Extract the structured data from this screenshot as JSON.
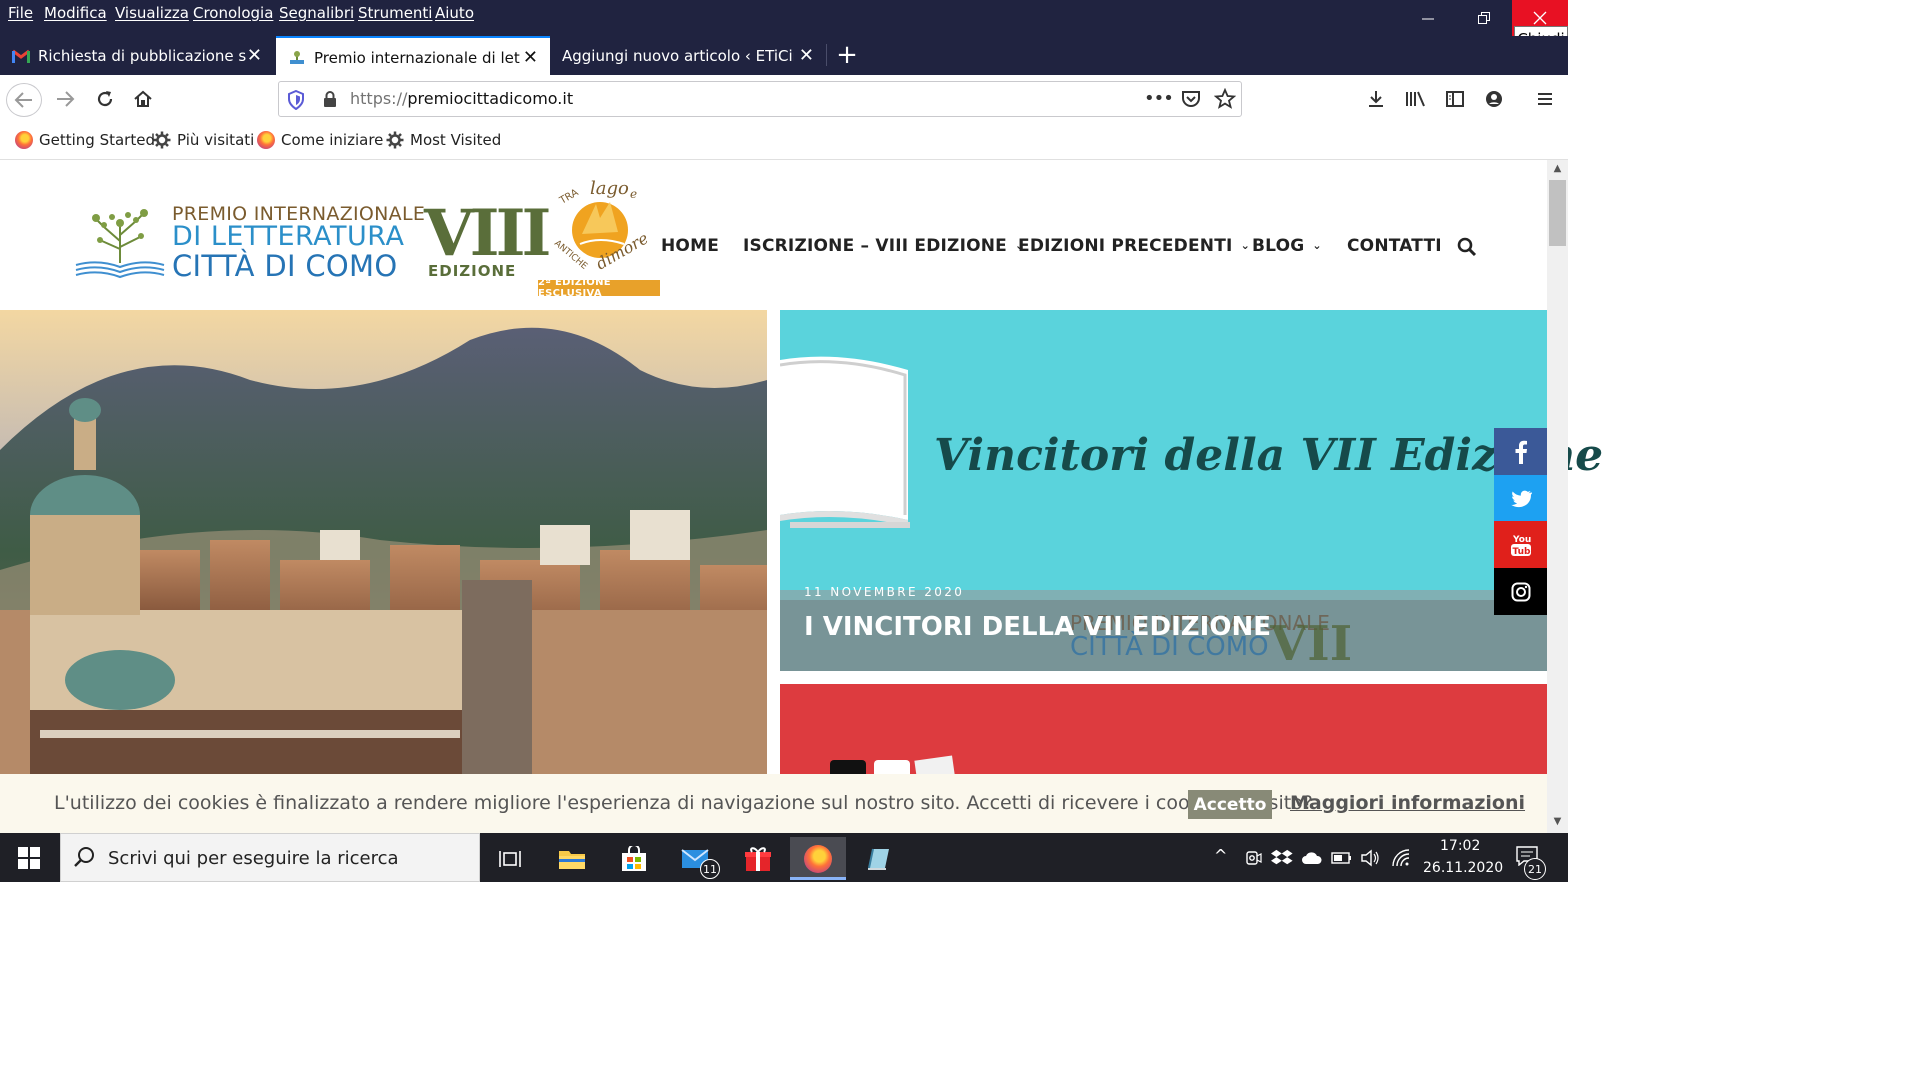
{
  "menubar": {
    "items": [
      "File",
      "Modifica",
      "Visualizza",
      "Cronologia",
      "Segnalibri",
      "Strumenti",
      "Aiuto"
    ],
    "close_tooltip": "Chiudi"
  },
  "tabs": [
    {
      "label": "Richiesta di pubblicazione sul V",
      "icon": "gmail-icon"
    },
    {
      "label": "Premio internazionale di lettera",
      "icon": "site-favicon",
      "active": true
    },
    {
      "label": "Aggiungi nuovo articolo ‹ ETiCinfor",
      "icon": "none"
    }
  ],
  "urlbar": {
    "scheme": "https://",
    "host": "premiocittadicomo.it"
  },
  "bookmarks": [
    {
      "label": "Getting Started",
      "icon": "firefox-icon"
    },
    {
      "label": "Più visitati",
      "icon": "gear-icon"
    },
    {
      "label": "Come iniziare",
      "icon": "firefox-icon"
    },
    {
      "label": "Most Visited",
      "icon": "gear-icon"
    }
  ],
  "site": {
    "logo": {
      "line1": "PREMIO INTERNAZIONALE",
      "line2": "DI LETTERATURA",
      "line3": "CITTÀ DI COMO",
      "edition_numeral": "VIII",
      "edition_word": "EDIZIONE"
    },
    "tralago": {
      "text1": "TRA lago e",
      "text2": "ANTICHE dimore",
      "badge": "2ª EDIZIONE ESCLUSIVA"
    },
    "nav": [
      {
        "label": "HOME",
        "dropdown": false
      },
      {
        "label": "ISCRIZIONE – VIII EDIZIONE",
        "dropdown": true
      },
      {
        "label": "EDIZIONI PRECEDENTI",
        "dropdown": true
      },
      {
        "label": "BLOG",
        "dropdown": true
      },
      {
        "label": "CONTATTI",
        "dropdown": false
      }
    ],
    "cards": [
      {
        "image_title": "Vincitori della VII Edizione",
        "date": "11 NOVEMBRE 2020",
        "title": "I VINCITORI DELLA VII EDIZIONE"
      }
    ],
    "cookie": {
      "text": "L'utilizzo dei cookies è finalizzato a rendere migliore l'esperienza di navigazione sul nostro sito. Accetti di ricevere i cookies dal sito?",
      "accept": "Accetto",
      "more": "Maggiori informazioni"
    }
  },
  "taskbar": {
    "search_placeholder": "Scrivi qui per eseguire la ricerca",
    "mail_badge": "11",
    "time": "17:02",
    "date": "26.11.2020",
    "notifications": "21"
  },
  "colors": {
    "chrome_dark": "#202340",
    "accent_blue": "#0a84ff",
    "card_teal": "#5ad3dc",
    "card_red": "#dd3b3f",
    "facebook": "#3b5998",
    "twitter": "#1da1f2",
    "youtube": "#e0201b",
    "instagram": "#000000"
  }
}
